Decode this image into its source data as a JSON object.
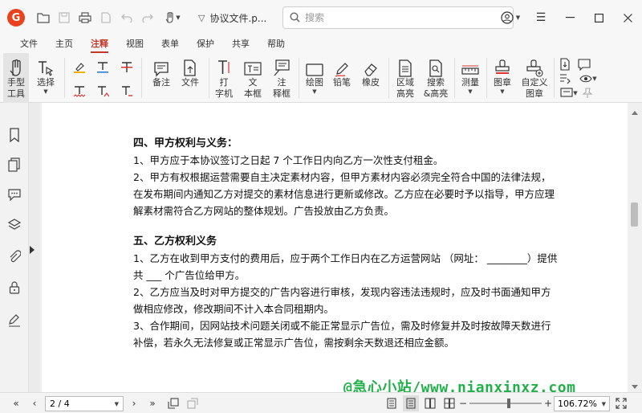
{
  "app": {
    "logo_letter": "G",
    "accent": "#e8431e"
  },
  "titlebar": {
    "document_name": "协议文件.p...",
    "search_placeholder": "搜索"
  },
  "menu": {
    "items": [
      "文件",
      "主页",
      "注释",
      "视图",
      "表单",
      "保护",
      "共享",
      "帮助"
    ],
    "active": "注释"
  },
  "ribbon": {
    "hand_tool": {
      "line1": "手型",
      "line2": "工具"
    },
    "select": "选择",
    "note": "备注",
    "file": "文件",
    "typewriter": {
      "line1": "打",
      "line2": "字机"
    },
    "textbox": {
      "line1": "文",
      "line2": "本框"
    },
    "callout": {
      "line1": "注",
      "line2": "释框"
    },
    "draw": "绘图",
    "pencil": "铅笔",
    "eraser": "橡皮",
    "area_highlight": {
      "line1": "区域",
      "line2": "高亮"
    },
    "search_highlight": {
      "line1": "搜索",
      "line2": "&高亮"
    },
    "measure": "测量",
    "stamp": "图章",
    "custom_stamp": {
      "line1": "自定义",
      "line2": "图章"
    }
  },
  "document": {
    "section4_title": "四、甲方权利与义务：",
    "section4_items": [
      "1、甲方应于本协议签订之日起 7 个工作日内向乙方一次性支付租金。",
      "2、甲方有权根据运营需要自主决定素材内容，但甲方素材内容必须完全符合中国的法律法规，在发布期间内通知乙方对提交的素材信息进行更新或修改。乙方应在必要时予以指导，甲方应理解素材需符合乙方网站的整体规划。广告投放由乙方负责。"
    ],
    "section5_title": "五、乙方权利义务",
    "section5_items": [
      "1、乙方在收到甲方支付的费用后，应于两个工作日内在乙方运营网站 （网址： ________）提供共 ___ 个广告位给甲方。",
      "2、乙方应当及时对甲方提交的广告内容进行审核，发现内容违法违规时，应及时书面通知甲方做相应修改，修改期间不计入本合同租期内。",
      "3、合作期间，因网站技术问题关闭或不能正常显示广告位，需及时修复并及时按故障天数进行补偿，若永久无法修复或正常显示广告位，需按剩余天数退还相应金额。"
    ]
  },
  "watermark": "@急心小站/www.nianxinxz.com",
  "status": {
    "page_display": "2 / 4",
    "zoom": "106.72%",
    "zoom_fraction": 0.55
  }
}
